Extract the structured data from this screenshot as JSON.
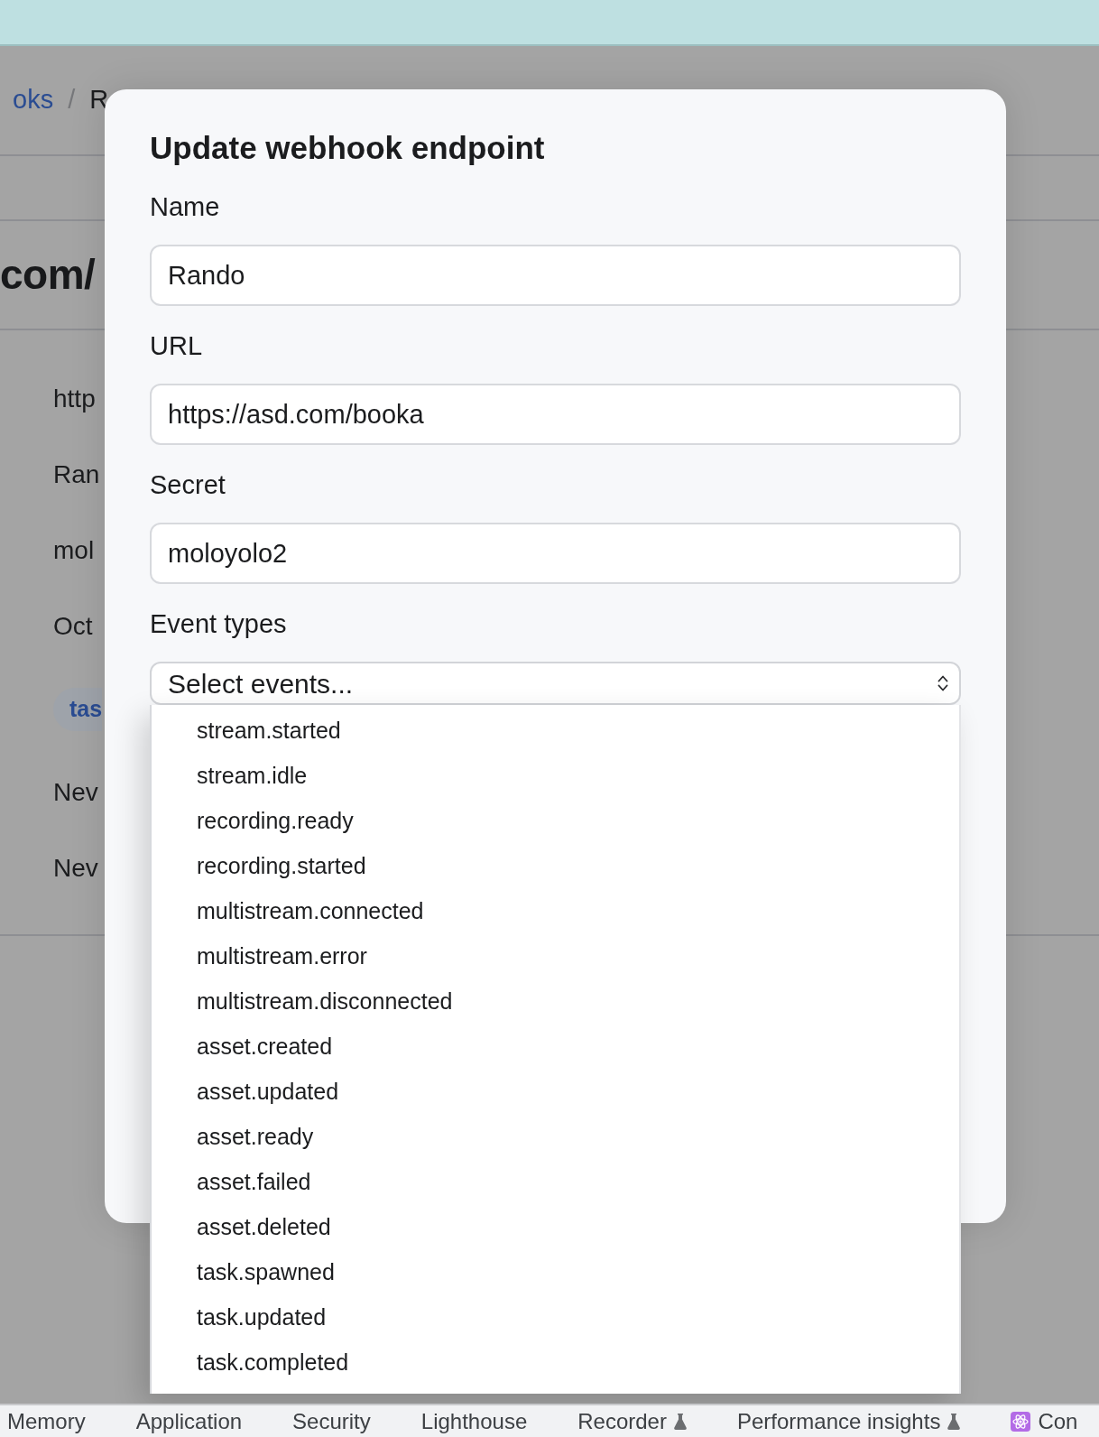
{
  "background_page": {
    "breadcrumb": {
      "items": [
        {
          "kind": "link",
          "text": "oks"
        },
        {
          "kind": "current",
          "text": "R"
        }
      ],
      "separator": "/"
    },
    "heading": "com/",
    "details": [
      {
        "kind": "text",
        "text": "http"
      },
      {
        "kind": "text",
        "text": "Ran"
      },
      {
        "kind": "text",
        "text": "mol"
      },
      {
        "kind": "text",
        "text": "Oct"
      },
      {
        "kind": "badge",
        "text": "tas"
      },
      {
        "kind": "text",
        "text": "Nev"
      },
      {
        "kind": "text",
        "text": "Nev"
      }
    ]
  },
  "modal": {
    "title": "Update webhook endpoint",
    "fields": [
      {
        "label": "Name",
        "value": "Rando"
      },
      {
        "label": "URL",
        "value": "https://asd.com/booka"
      },
      {
        "label": "Secret",
        "value": "moloyolo2"
      }
    ],
    "event_types": {
      "label": "Event types",
      "placeholder": "Select events...",
      "expanded": true,
      "options": [
        {
          "label": "stream.started",
          "selected": false
        },
        {
          "label": "stream.idle",
          "selected": false
        },
        {
          "label": "recording.ready",
          "selected": false
        },
        {
          "label": "recording.started",
          "selected": false
        },
        {
          "label": "multistream.connected",
          "selected": false
        },
        {
          "label": "multistream.error",
          "selected": false
        },
        {
          "label": "multistream.disconnected",
          "selected": false
        },
        {
          "label": "asset.created",
          "selected": false
        },
        {
          "label": "asset.updated",
          "selected": false
        },
        {
          "label": "asset.ready",
          "selected": false
        },
        {
          "label": "asset.failed",
          "selected": false
        },
        {
          "label": "asset.deleted",
          "selected": false
        },
        {
          "label": "task.spawned",
          "selected": false
        },
        {
          "label": "task.updated",
          "selected": false
        },
        {
          "label": "task.completed",
          "selected": false
        }
      ]
    }
  },
  "devtools_tabs": [
    {
      "label": "Memory",
      "kind": "plain",
      "selected": false
    },
    {
      "label": "Application",
      "kind": "plain",
      "selected": false
    },
    {
      "label": "Security",
      "kind": "plain",
      "selected": false
    },
    {
      "label": "Lighthouse",
      "kind": "plain",
      "selected": false
    },
    {
      "label": "Recorder",
      "kind": "experimental",
      "selected": false
    },
    {
      "label": "Performance insights",
      "kind": "experimental",
      "selected": false
    },
    {
      "label": "Con",
      "kind": "extension",
      "selected": false
    }
  ]
}
